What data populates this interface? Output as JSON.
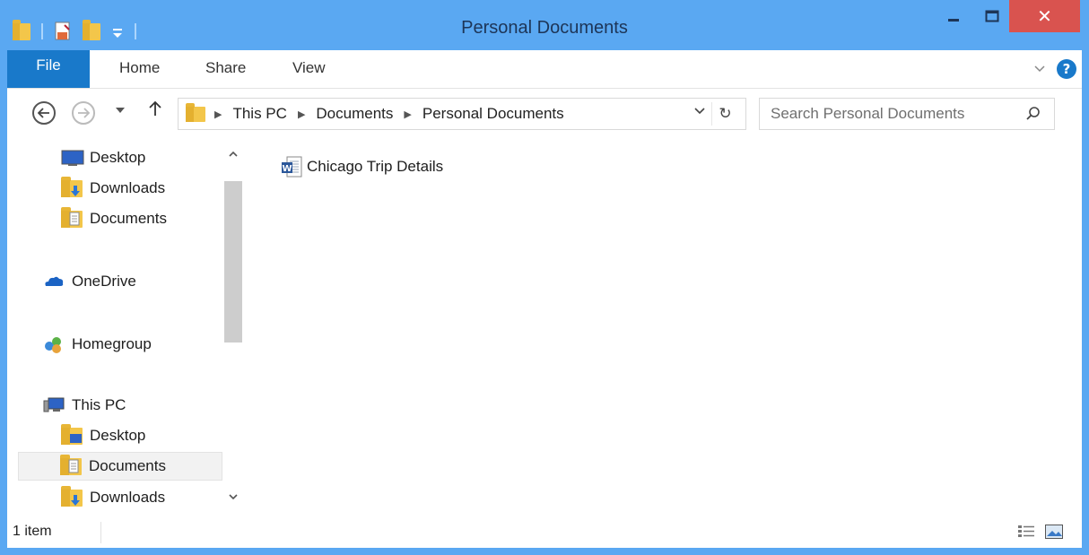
{
  "window": {
    "title": "Personal Documents",
    "close_glyph": "✕"
  },
  "ribbon": {
    "file_tab": "File",
    "tabs": [
      "Home",
      "Share",
      "View"
    ],
    "help_glyph": "?"
  },
  "address_bar": {
    "breadcrumb": [
      "This PC",
      "Documents",
      "Personal Documents"
    ],
    "refresh_glyph": "↻"
  },
  "search": {
    "placeholder": "Search Personal Documents"
  },
  "navigation": {
    "items": [
      {
        "label": "Desktop",
        "icon": "desktop-icon"
      },
      {
        "label": "Downloads",
        "icon": "downloads-folder-icon"
      },
      {
        "label": "Documents",
        "icon": "documents-folder-icon"
      },
      {
        "label": "OneDrive",
        "icon": "onedrive-cloud-icon"
      },
      {
        "label": "Homegroup",
        "icon": "homegroup-icon"
      },
      {
        "label": "This PC",
        "icon": "computer-icon"
      },
      {
        "label": "Desktop",
        "icon": "desktop-folder-icon"
      },
      {
        "label": "Documents",
        "icon": "documents-folder-icon",
        "selected": true
      },
      {
        "label": "Downloads",
        "icon": "downloads-folder-icon"
      }
    ]
  },
  "files": [
    {
      "name": "Chicago Trip Details",
      "icon": "word-document-icon"
    }
  ],
  "status_bar": {
    "item_count": "1 item"
  },
  "colors": {
    "titlebar": "#5aa8f2",
    "file_tab": "#1979ca",
    "close_button": "#d9534f",
    "folder": "#f3c64a"
  }
}
